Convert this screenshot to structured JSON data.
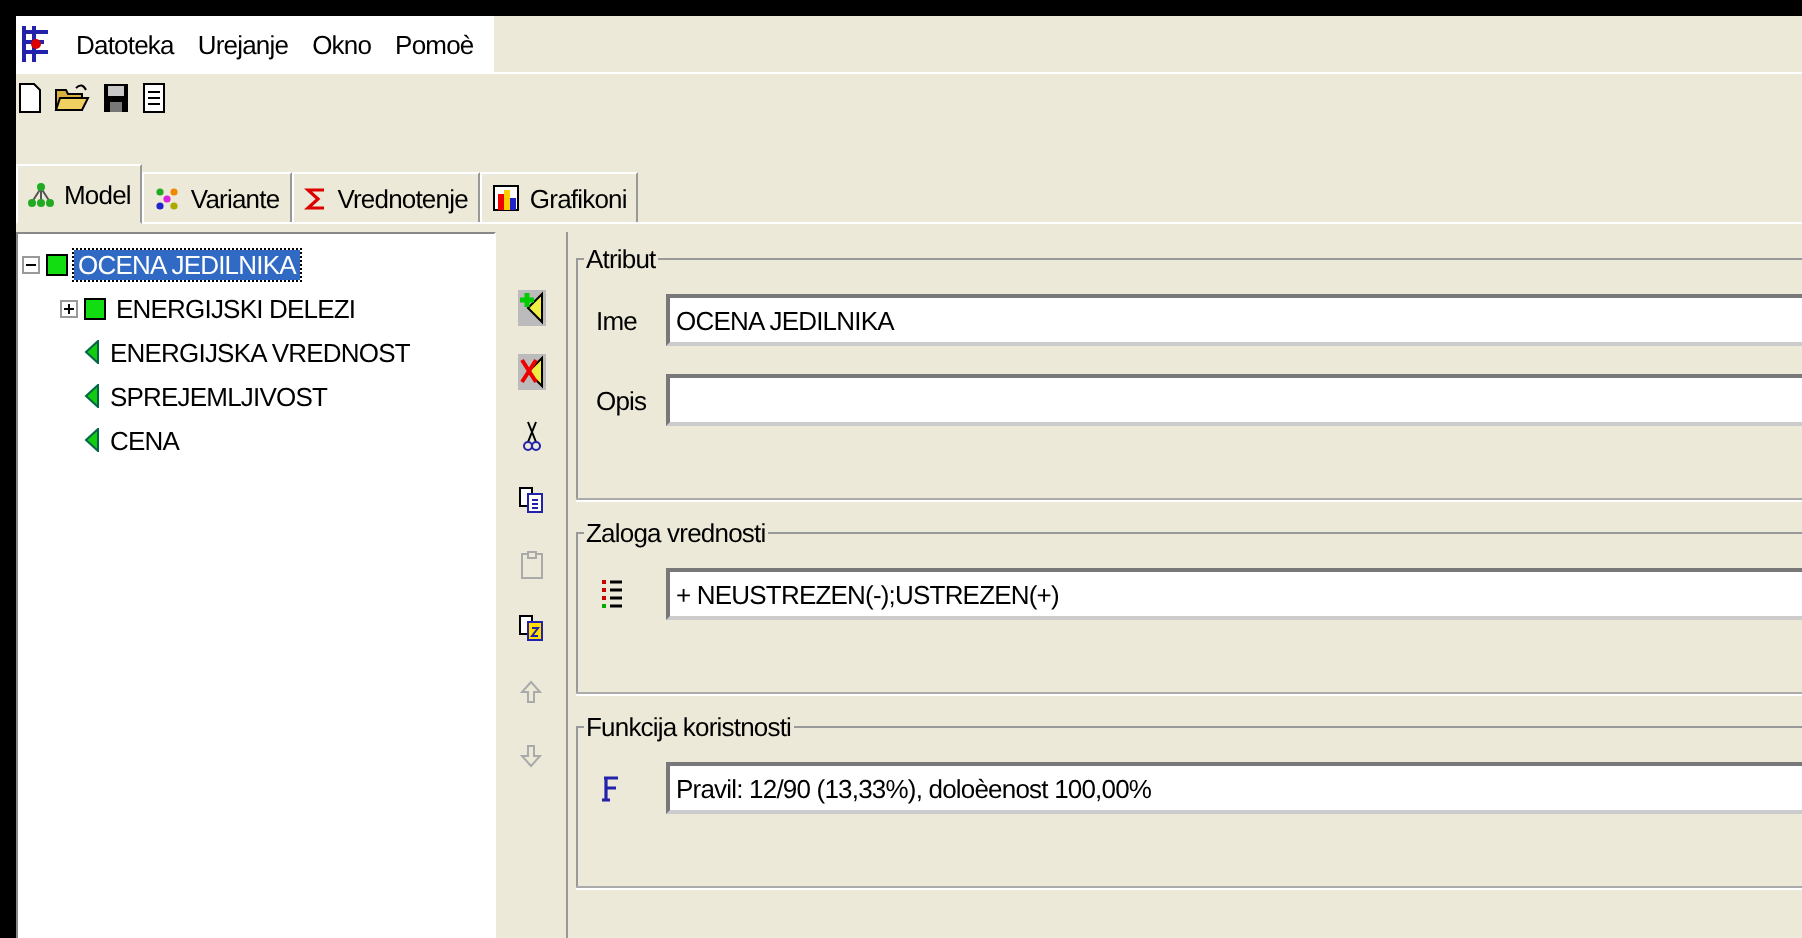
{
  "menu": [
    {
      "label": "Datoteka"
    },
    {
      "label": "Urejanje"
    },
    {
      "label": "Okno"
    },
    {
      "label": "Pomoè"
    }
  ],
  "toolbar": [
    {
      "kind": "new"
    },
    {
      "kind": "open"
    },
    {
      "kind": "save"
    },
    {
      "kind": "report"
    }
  ],
  "tabs": [
    {
      "label": "Model",
      "kind": "tree",
      "selected": true
    },
    {
      "label": "Variante",
      "kind": "dots",
      "selected": false
    },
    {
      "label": "Vrednotenje",
      "kind": "sigma",
      "selected": false
    },
    {
      "label": "Grafikoni",
      "kind": "chart",
      "selected": false
    }
  ],
  "tree": [
    {
      "label": "OCENA JEDILNIKA",
      "kind": "aggregate",
      "selected": true,
      "expanded": true,
      "children": [
        {
          "label": "ENERGIJSKI DELEZI",
          "kind": "aggregate",
          "selected": false,
          "expanded": false
        },
        {
          "label": "ENERGIJSKA VREDNOST",
          "kind": "basic",
          "selected": false
        },
        {
          "label": "SPREJEMLJIVOST",
          "kind": "basic",
          "selected": false
        },
        {
          "label": "CENA",
          "kind": "basic",
          "selected": false
        }
      ]
    }
  ],
  "side_tools": [
    {
      "kind": "add",
      "disabled": false
    },
    {
      "kind": "delete",
      "disabled": false
    },
    {
      "kind": "cut",
      "disabled": false
    },
    {
      "kind": "copy",
      "disabled": false
    },
    {
      "kind": "paste",
      "disabled": true
    },
    {
      "kind": "copy-special",
      "disabled": false
    },
    {
      "kind": "up",
      "disabled": true
    },
    {
      "kind": "down",
      "disabled": true
    }
  ],
  "groups": [
    {
      "title": "Atribut",
      "fields": [
        {
          "label": "Ime",
          "value": "OCENA JEDILNIKA"
        },
        {
          "label": "Opis"
        }
      ]
    },
    {
      "title": "Zaloga vrednosti",
      "fields": [
        {
          "kind": "values",
          "value": "+ NEUSTREZEN(-);USTREZEN(+)"
        }
      ]
    },
    {
      "title": "Funkcija koristnosti",
      "fields": [
        {
          "kind": "utility",
          "value": "Pravil: 12/90 (13,33%), doloèenost 100,00%"
        }
      ]
    }
  ]
}
